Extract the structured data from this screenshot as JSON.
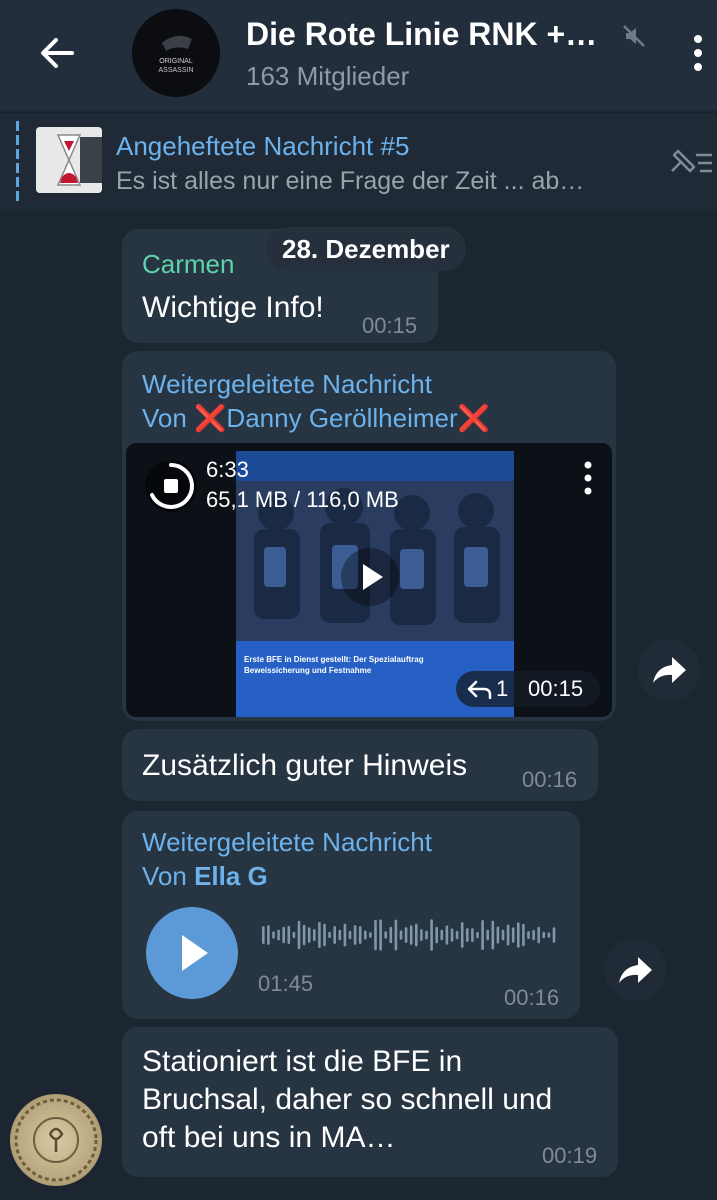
{
  "header": {
    "title": "Die Rote Linie RNK +…",
    "subtitle": "163 Mitglieder",
    "avatar_text_1": "ORIGINAL",
    "avatar_text_2": "ASSASSIN",
    "icons": [
      "back-arrow-icon",
      "mute-icon",
      "more-vert-icon"
    ]
  },
  "pinned": {
    "title": "Angeheftete Nachricht #5",
    "text": "Es ist alles nur eine Frage der Zeit ... ab…"
  },
  "date_pill": "28. Dezember",
  "messages": [
    {
      "sender": "Carmen",
      "text": "Wichtige Info!",
      "time": "00:15"
    },
    {
      "fwd_label": "Weitergeleitete Nachricht",
      "fwd_from_prefix": "Von",
      "fwd_from": "❌Danny Geröllheimer❌",
      "video": {
        "duration": "6:33",
        "progress": "65,1 MB / 116,0 MB",
        "replies": "1",
        "time": "00:15"
      },
      "video_caption_1": "Erste BFE in Dienst gestellt: Der Spezialauftrag",
      "video_caption_2": "Beweissicherung und Festnahme"
    },
    {
      "text": "Zusätzlich guter Hinweis",
      "time": "00:16"
    },
    {
      "fwd_label": "Weitergeleitete Nachricht",
      "fwd_from_prefix": "Von",
      "fwd_from": "Ella G",
      "voice": {
        "duration": "01:45",
        "time": "00:16"
      }
    },
    {
      "text_lines": [
        "Stationiert ist die BFE in",
        "Bruchsal, daher so schnell und",
        "oft bei uns in MA…"
      ],
      "time": "00:19"
    }
  ],
  "colors": {
    "accent": "#6cb2ec",
    "sender": "#5fd3a8",
    "bubble": "#273442",
    "background": "#1b2631"
  }
}
